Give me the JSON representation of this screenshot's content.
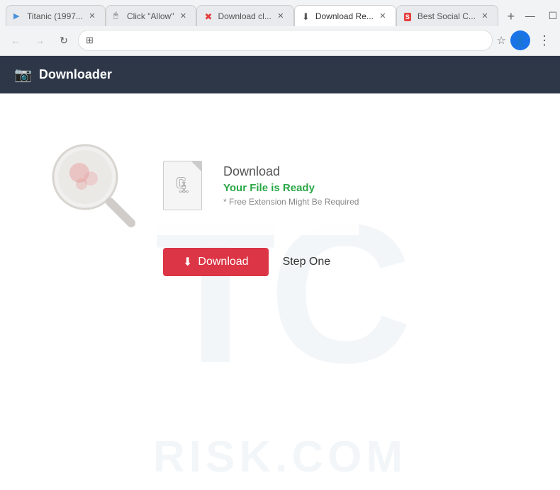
{
  "browser": {
    "tabs": [
      {
        "id": "tab1",
        "favicon": "film",
        "title": "Titanic (1997...",
        "active": false,
        "closable": true
      },
      {
        "id": "tab2",
        "favicon": "cursor",
        "title": "Click \"Allow\"",
        "active": false,
        "closable": true
      },
      {
        "id": "tab3",
        "favicon": "x-error",
        "title": "Download cl...",
        "active": false,
        "closable": true
      },
      {
        "id": "tab4",
        "favicon": "download",
        "title": "Download Re...",
        "active": true,
        "closable": true
      },
      {
        "id": "tab5",
        "favicon": "social",
        "title": "Best Social C...",
        "active": false,
        "closable": true
      }
    ],
    "add_tab_label": "+",
    "window_controls": {
      "minimize": "—",
      "maximize": "☐",
      "close": "✕"
    },
    "address_bar": {
      "url": "",
      "star_icon": "☆"
    }
  },
  "page": {
    "header": {
      "icon": "📷",
      "title": "Downloader"
    },
    "watermark": {
      "letters": "TC",
      "bottom": "RISK.COM"
    },
    "card": {
      "download_title": "Download",
      "file_ready": "Your File is Ready",
      "extension_note": "* Free Extension Might Be Required",
      "download_button": "Download",
      "step_label": "Step One"
    }
  }
}
